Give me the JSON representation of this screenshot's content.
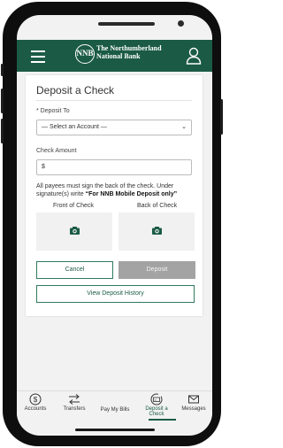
{
  "colors": {
    "brand_green": "#1b5b45",
    "disabled_gray": "#a3a3a3"
  },
  "header": {
    "bank_name_line1": "The Northumberland",
    "bank_name_line2": "National Bank",
    "logo_letters": "NNB"
  },
  "deposit": {
    "title": "Deposit a Check",
    "deposit_to_label": "* Deposit To",
    "account_select_value": "— Select an Account —",
    "check_amount_label": "Check Amount",
    "amount_prefix": "$",
    "note_text": "All payees must sign the back of the check. Under signature(s) write ",
    "note_bold": "“For NNB Mobile Deposit only”",
    "front_label": "Front of Check",
    "back_label": "Back of Check",
    "cancel_label": "Cancel",
    "deposit_label": "Deposit",
    "history_label": "View Deposit History"
  },
  "tabs": [
    {
      "label": "Accounts",
      "icon": "dollar-circle-icon"
    },
    {
      "label": "Transfers",
      "icon": "transfer-arrows-icon"
    },
    {
      "label": "Pay My Bills",
      "icon": "blank"
    },
    {
      "label": "Deposit a Check",
      "icon": "check-deposit-icon"
    },
    {
      "label": "Messages",
      "icon": "envelope-icon"
    }
  ]
}
